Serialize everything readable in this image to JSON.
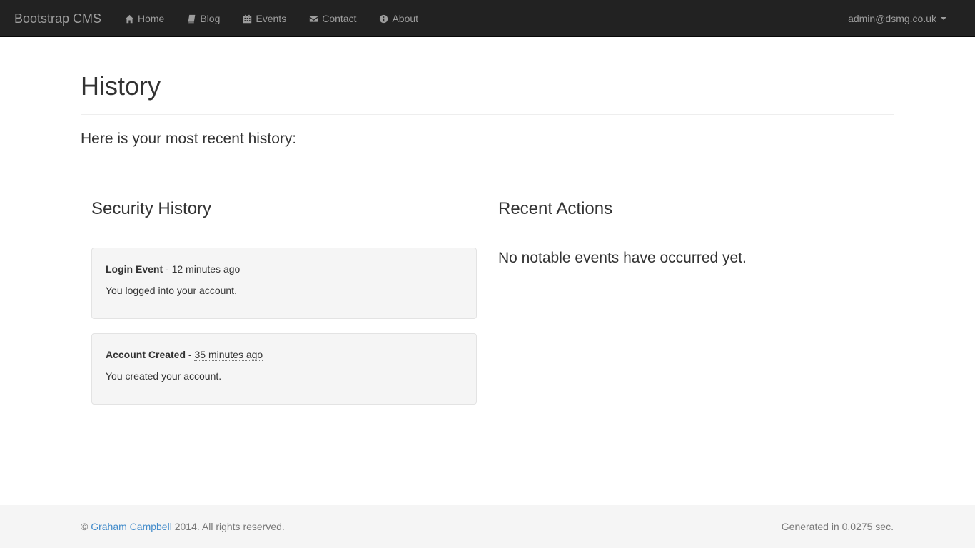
{
  "navbar": {
    "brand": "Bootstrap CMS",
    "items": [
      {
        "label": "Home",
        "icon": "home-icon"
      },
      {
        "label": "Blog",
        "icon": "book-icon"
      },
      {
        "label": "Events",
        "icon": "calendar-icon"
      },
      {
        "label": "Contact",
        "icon": "envelope-icon"
      },
      {
        "label": "About",
        "icon": "info-icon"
      }
    ],
    "user": "admin@dsmg.co.uk"
  },
  "page": {
    "title": "History",
    "lead": "Here is your most recent history:"
  },
  "security": {
    "title": "Security History",
    "events": [
      {
        "name": "Login Event",
        "separator": " - ",
        "time": "12 minutes ago",
        "text": "You logged into your account."
      },
      {
        "name": "Account Created",
        "separator": " - ",
        "time": "35 minutes ago",
        "text": "You created your account."
      }
    ]
  },
  "actions": {
    "title": "Recent Actions",
    "empty": "No notable events have occurred yet."
  },
  "footer": {
    "copyright": "©",
    "author": "Graham Campbell",
    "rights": "2014. All rights reserved.",
    "generated": "Generated in 0.0275 sec."
  },
  "colors": {
    "navbar_bg": "#222222",
    "nav_text": "#9d9d9d",
    "link": "#428bca",
    "footer_bg": "#f5f5f5"
  }
}
